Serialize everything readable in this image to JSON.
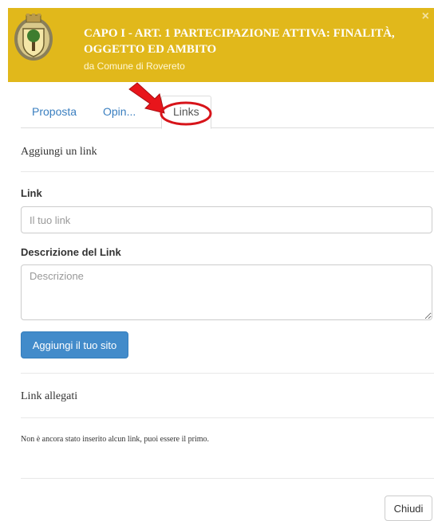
{
  "header": {
    "title": "CAPO I - ART. 1 PARTECIPAZIONE ATTIVA: FINALITÀ, OGGETTO ED AMBITO",
    "subtitle": "da Comune di Rovereto",
    "close_symbol": "×",
    "accent_color": "#e1b81b"
  },
  "tabs": [
    {
      "label": "Proposta"
    },
    {
      "label": "Opin..."
    },
    {
      "label": "Links"
    }
  ],
  "add_link": {
    "section_title": "Aggiungi un link",
    "link_label": "Link",
    "link_placeholder": "Il tuo link",
    "desc_label": "Descrizione del Link",
    "desc_placeholder": "Descrizione",
    "submit_label": "Aggiungi il tuo sito"
  },
  "attached": {
    "section_title": "Link allegati",
    "empty_message": "Non è ancora stato inserito alcun link, puoi essere il primo."
  },
  "footer": {
    "close_label": "Chiudi"
  },
  "icons": [
    "crest-icon",
    "red-arrow-icon",
    "highlight-circle-icon",
    "close-icon"
  ]
}
